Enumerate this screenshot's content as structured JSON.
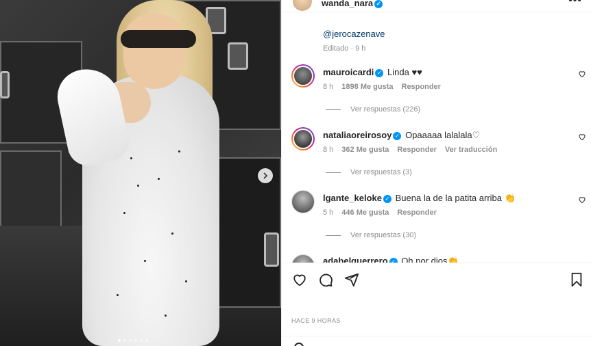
{
  "post": {
    "author": "wanda_nara",
    "more_label": "•••"
  },
  "caption": {
    "mention": "@jerocazenave",
    "edited": "Editado · 9 h"
  },
  "comments": [
    {
      "user": "mauroicardi",
      "verified": true,
      "text": "Linda ♥♥",
      "time": "8 h",
      "likes": "1898 Me gusta",
      "reply": "Responder",
      "translate": "",
      "view_replies": "Ver respuestas (226)"
    },
    {
      "user": "nataliaoreirosoy",
      "verified": true,
      "text": "Opaaaaa lalalala♡",
      "time": "8 h",
      "likes": "362 Me gusta",
      "reply": "Responder",
      "translate": "Ver traducción",
      "view_replies": "Ver respuestas (3)"
    },
    {
      "user": "lgante_keloke",
      "verified": true,
      "text": "Buena la de la patita arriba 👏",
      "time": "5 h",
      "likes": "446 Me gusta",
      "reply": "Responder",
      "translate": "",
      "view_replies": "Ver respuestas (30)"
    },
    {
      "user": "adabelguerrero",
      "verified": true,
      "text": "Oh por dios👏"
    }
  ],
  "footer": {
    "time_ago": "HACE 9 HORAS"
  },
  "icons": {
    "more": "more-options-icon",
    "like": "heart-icon",
    "comment": "comment-icon",
    "share": "share-icon",
    "save": "bookmark-icon",
    "next": "chevron-right-icon",
    "verified": "verified-badge-icon"
  },
  "colors": {
    "verified": "#0095f6",
    "muted_text": "#8e8e8e",
    "mention": "#00376b"
  },
  "carousel": {
    "count": 6,
    "active_index": 0
  }
}
